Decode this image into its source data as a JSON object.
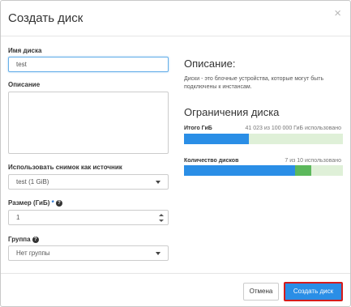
{
  "dialog": {
    "title": "Создать диск",
    "close_glyph": "×"
  },
  "form": {
    "name_label": "Имя диска",
    "name_value": "test",
    "description_label": "Описание",
    "description_value": "",
    "source_label": "Использовать снимок как источник",
    "source_value": "test (1 GiB)",
    "size_label": "Размер (ГиБ)",
    "size_required_mark": "*",
    "size_value": "1",
    "group_label": "Группа",
    "group_value": "Нет группы",
    "help_glyph": "?"
  },
  "info": {
    "description_heading": "Описание:",
    "description_text": "Диски - это блочные устройства, которые могут быть подключены к инстансам.",
    "limits_heading": "Ограничения диска",
    "quotas": [
      {
        "label": "Итого ГиБ",
        "usage_text": "41 023 из 100 000 ГиБ использовано",
        "used_fraction": 0.41,
        "new_fraction": 0.0
      },
      {
        "label": "Количество дисков",
        "usage_text": "7 из 10 использовано",
        "used_fraction": 0.7,
        "new_fraction": 0.1
      }
    ]
  },
  "buttons": {
    "cancel_label": "Отмена",
    "create_label": "Создать диск"
  },
  "colors": {
    "accent": "#2a8ee6",
    "quota_new": "#5cb85c",
    "quota_free": "#dff0d8",
    "highlight_border": "#d61b1b"
  },
  "icons": {
    "close": "close-icon",
    "select_caret": "chevron-down-icon",
    "help": "help-icon",
    "spinner": "number-spinner-icon"
  }
}
